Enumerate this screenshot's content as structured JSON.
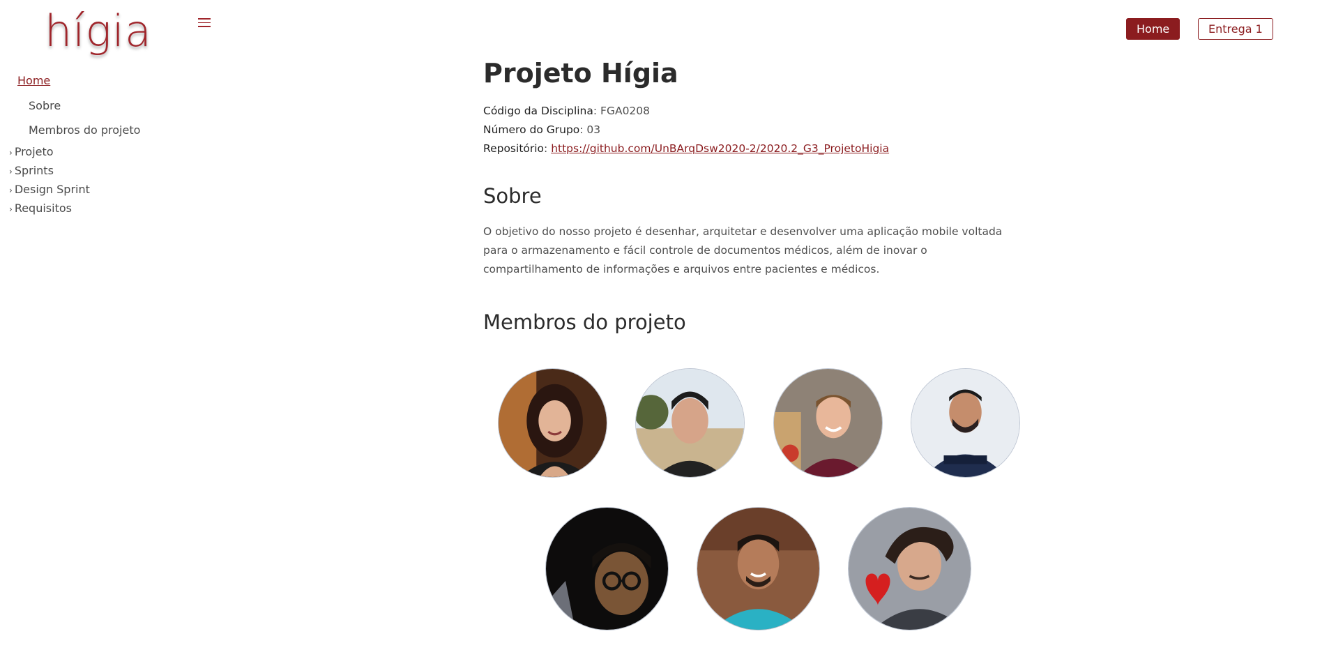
{
  "brand": {
    "logo_text": "hígia",
    "accent_color": "#8b1c1f"
  },
  "header": {
    "menu_icon": "hamburger-icon",
    "buttons": [
      {
        "label": "Home",
        "active": true
      },
      {
        "label": "Entrega 1",
        "active": false
      }
    ]
  },
  "sidebar": {
    "home_label": "Home",
    "sub_items": [
      "Sobre",
      "Membros do projeto"
    ],
    "groups": [
      "Projeto",
      "Sprints",
      "Design Sprint",
      "Requisitos"
    ],
    "chevron_icon": "chevron-right-icon"
  },
  "main": {
    "title": "Projeto Hígia",
    "meta": {
      "disciplina_label": "Código da Disciplina",
      "disciplina_value": ": FGA0208",
      "grupo_label": "Número do Grupo",
      "grupo_value": ": 03",
      "repo_label": "Repositório",
      "repo_sep": ": ",
      "repo_link": "https://github.com/UnBArqDsw2020-2/2020.2_G3_ProjetoHigia"
    },
    "sobre_heading": "Sobre",
    "sobre_text": "O objetivo do nosso projeto é desenhar, arquitetar e desenvolver uma aplicação mobile voltada para o armazenamento e fácil controle de documentos médicos, além de inovar o compartilhamento de informações e arquivos entre pacientes e médicos.",
    "membros_heading": "Membros do projeto",
    "members_count": 7
  }
}
